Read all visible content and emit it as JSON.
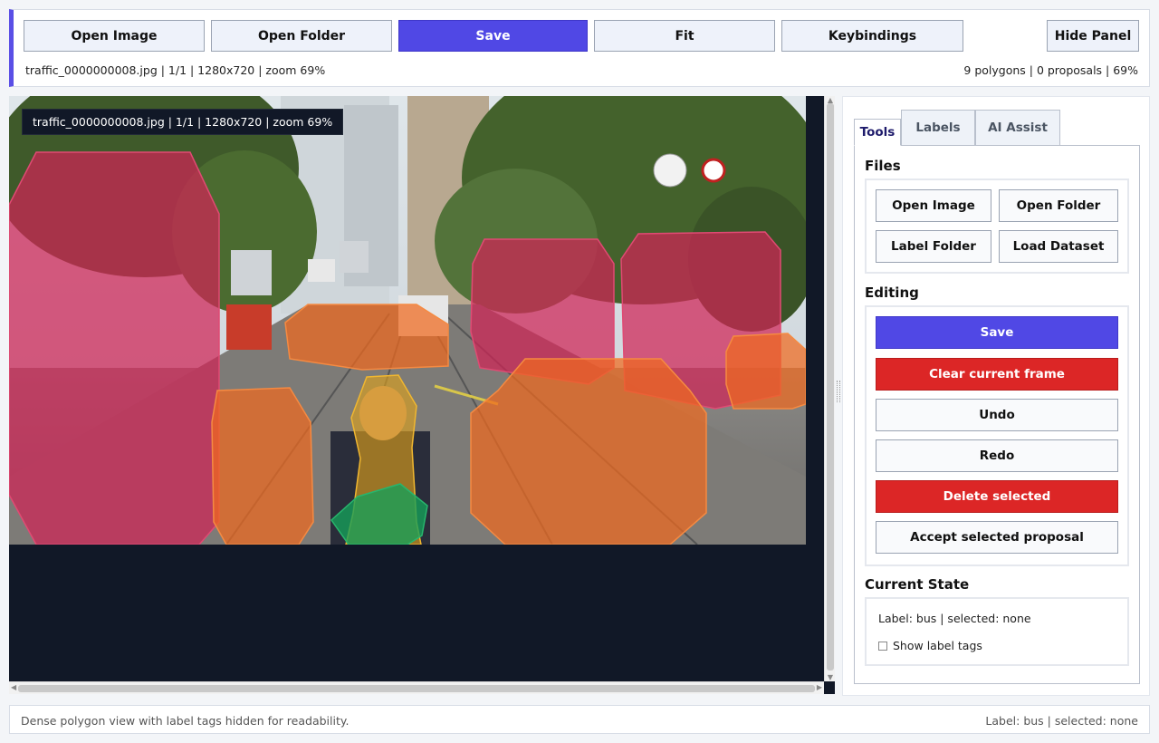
{
  "toolbar": {
    "open_image": "Open Image",
    "open_folder": "Open Folder",
    "save": "Save",
    "fit": "Fit",
    "keybindings": "Keybindings",
    "hide_panel": "Hide Panel",
    "status_left": "traffic_0000000008.jpg | 1/1 | 1280x720 | zoom 69%",
    "status_right": "9 polygons | 0 proposals | 69%"
  },
  "canvas": {
    "overlay_label": "traffic_0000000008.jpg | 1/1 | 1280x720 | zoom 69%",
    "polygon_colors": {
      "bus": "#d02456",
      "car": "#f06a1e",
      "person": "#e0a21a",
      "bicycle": "#15a05a"
    }
  },
  "panel": {
    "tabs": [
      "Tools",
      "Labels",
      "AI Assist"
    ],
    "active_tab": "Tools",
    "files": {
      "title": "Files",
      "open_image": "Open Image",
      "open_folder": "Open Folder",
      "label_folder": "Label Folder",
      "load_dataset": "Load Dataset"
    },
    "editing": {
      "title": "Editing",
      "save": "Save",
      "clear": "Clear current frame",
      "undo": "Undo",
      "redo": "Redo",
      "delete": "Delete selected",
      "accept": "Accept selected proposal"
    },
    "state": {
      "title": "Current State",
      "text": "Label: bus | selected: none",
      "show_tags": "Show label tags",
      "show_tags_checked": false
    }
  },
  "footer": {
    "left": "Dense polygon view with label tags hidden for readability.",
    "right": "Label: bus | selected: none"
  },
  "colors": {
    "accent": "#5048e5",
    "danger": "#dc2626",
    "canvas_bg": "#111827"
  }
}
